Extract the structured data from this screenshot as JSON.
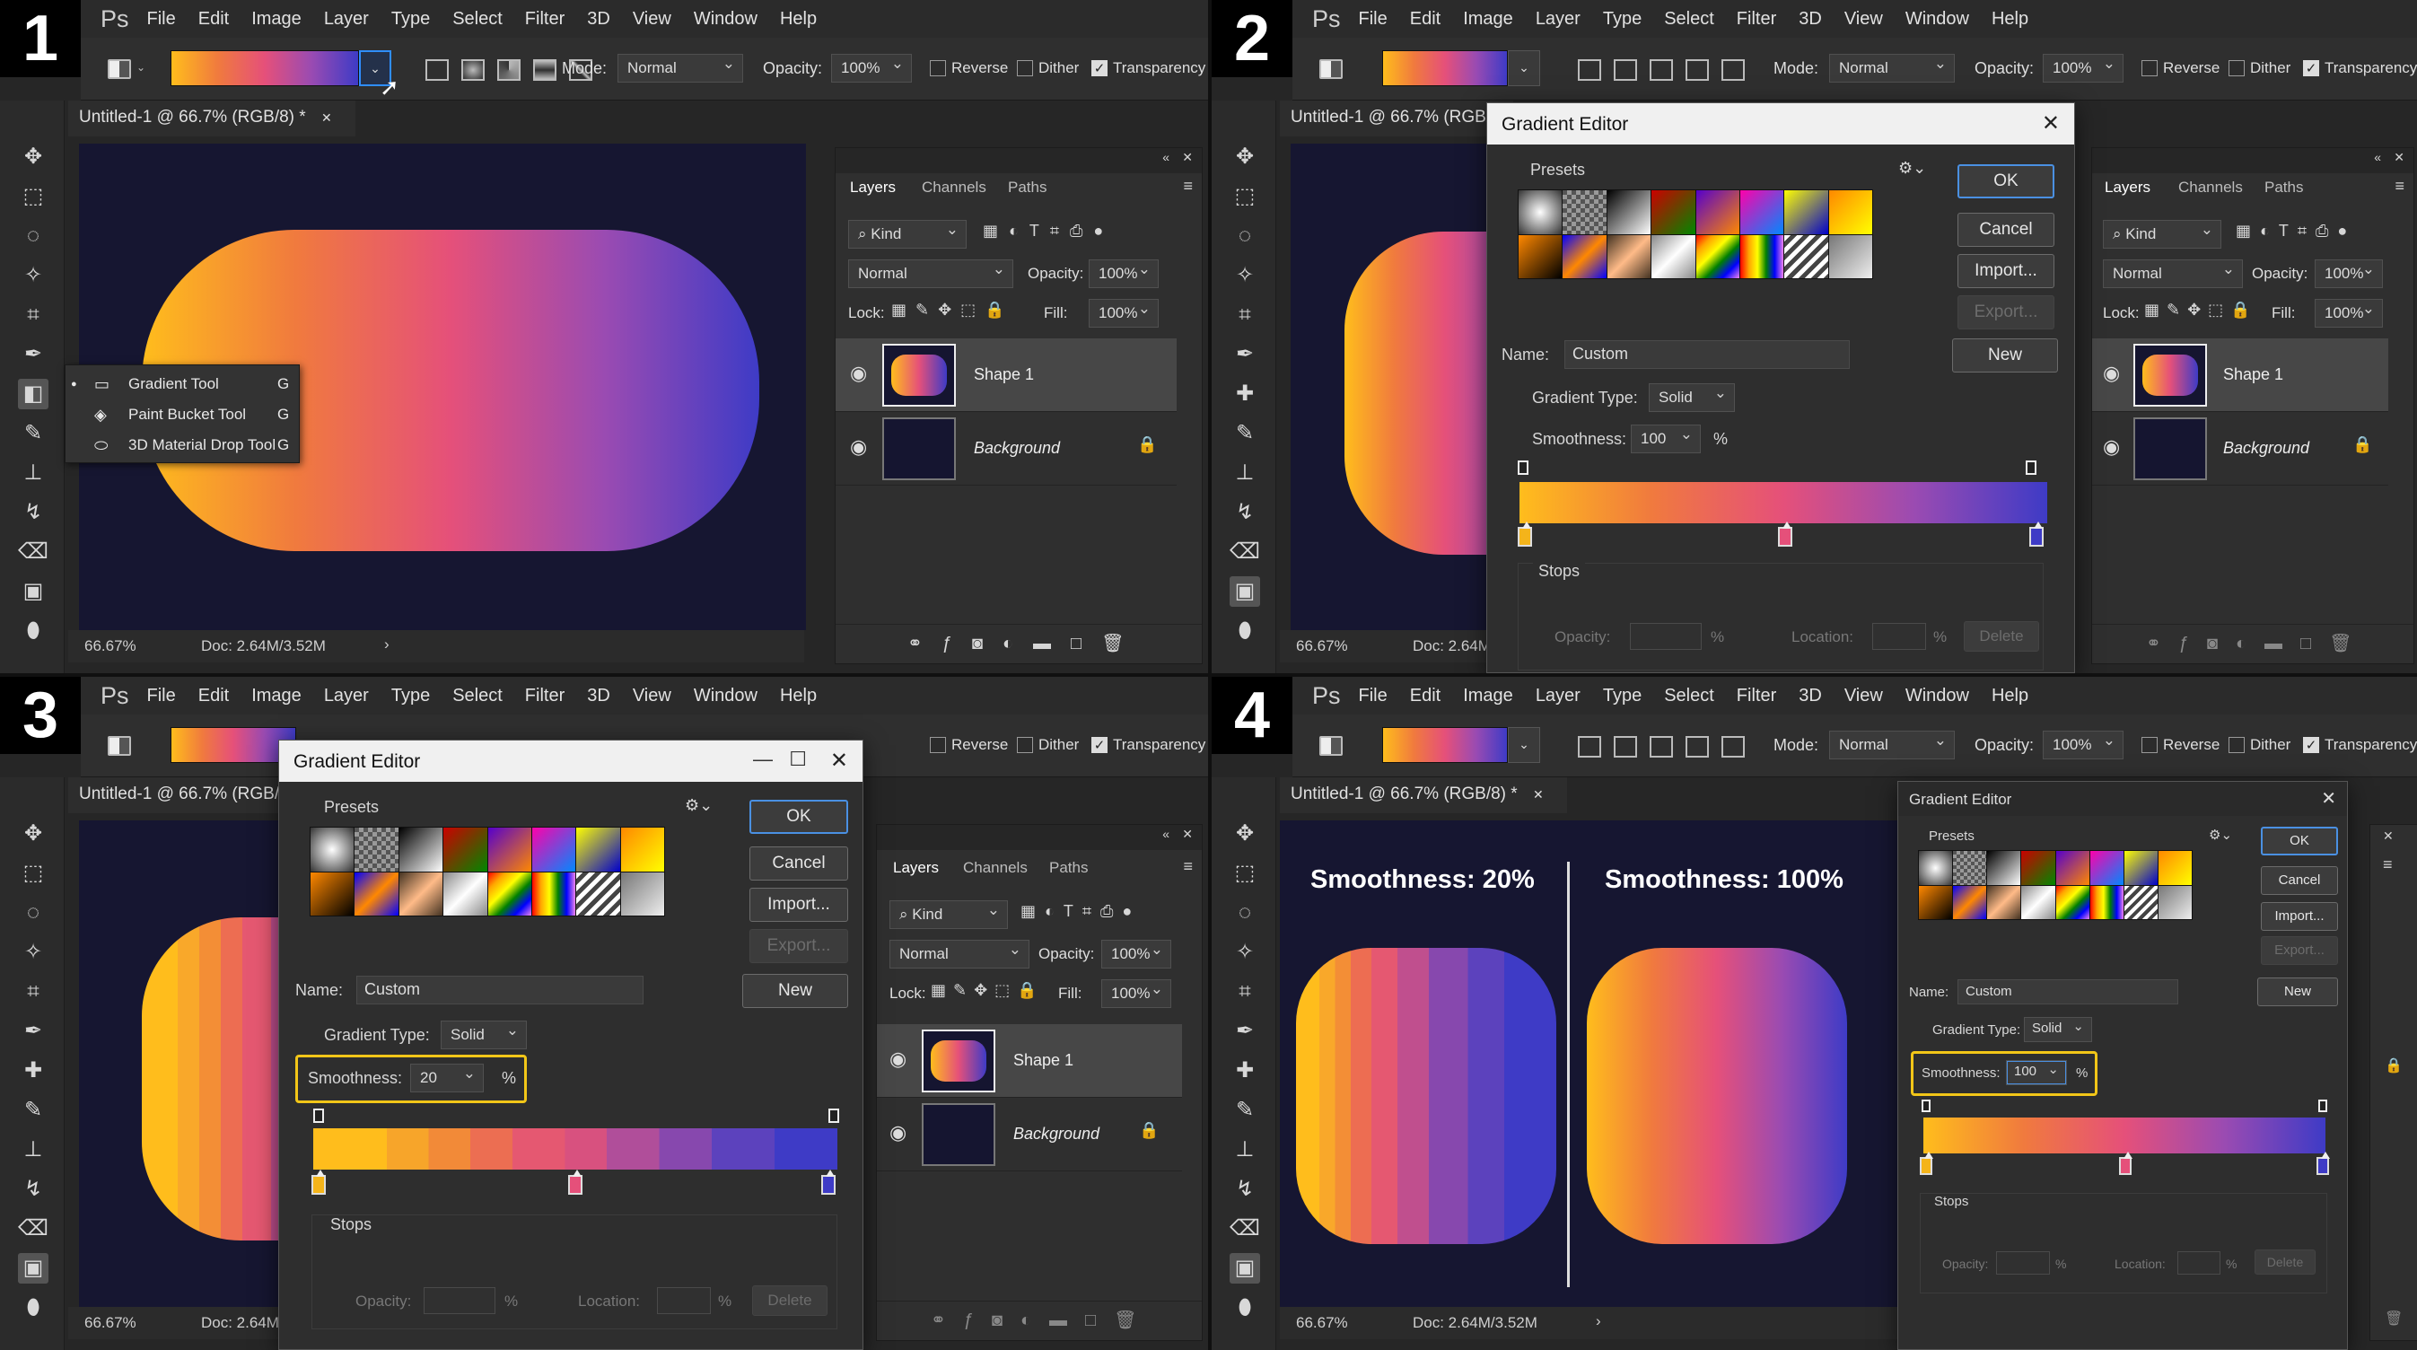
{
  "panels": [
    {
      "number": "1"
    },
    {
      "number": "2"
    },
    {
      "number": "3"
    },
    {
      "number": "4"
    }
  ],
  "app": {
    "logo": "Ps",
    "menu": [
      "File",
      "Edit",
      "Image",
      "Layer",
      "Type",
      "Select",
      "Filter",
      "3D",
      "View",
      "Window",
      "Help"
    ]
  },
  "options": {
    "mode_label": "Mode:",
    "mode_value": "Normal",
    "opacity_label": "Opacity:",
    "opacity_value": "100%",
    "reverse": "Reverse",
    "dither": "Dither",
    "transparency": "Transparency",
    "reverse_checked": false,
    "dither_checked": false,
    "transparency_checked": true
  },
  "document": {
    "tab_title": "Untitled-1 @ 66.7% (RGB/8) *",
    "tab_title_short": "Untitled-1 @ 66.7% (RGB/",
    "zoom": "66.67%",
    "doc_size": "Doc: 2.64M/3.52M"
  },
  "tool_menu": {
    "items": [
      {
        "label": "Gradient Tool",
        "key": "G",
        "icon": "gradient-icon"
      },
      {
        "label": "Paint Bucket Tool",
        "key": "G",
        "icon": "paint-bucket-icon"
      },
      {
        "label": "3D Material Drop Tool",
        "key": "G",
        "icon": "3d-material-drop-icon"
      }
    ]
  },
  "layers_panel": {
    "tabs": [
      "Layers",
      "Channels",
      "Paths"
    ],
    "filter_kind_q1": "Kind",
    "filter_kind": "Kind",
    "blend_mode": "Normal",
    "opacity_label": "Opacity:",
    "opacity_value": "100%",
    "lock_label": "Lock:",
    "fill_label": "Fill:",
    "fill_value": "100%",
    "layers": [
      {
        "name": "Shape 1",
        "selected": true,
        "locked": false
      },
      {
        "name": "Background",
        "selected": false,
        "locked": true
      }
    ]
  },
  "gradient_editor": {
    "title": "Gradient Editor",
    "presets_label": "Presets",
    "ok": "OK",
    "cancel": "Cancel",
    "import": "Import...",
    "export": "Export...",
    "new": "New",
    "name_label": "Name:",
    "name_value": "Custom",
    "gradient_type_label": "Gradient Type:",
    "gradient_type_value": "Solid",
    "smoothness_label": "Smoothness:",
    "smoothness_q2": "100",
    "smoothness_q3": "20",
    "smoothness_q4": "100",
    "percent": "%",
    "stops_label": "Stops",
    "stop_opacity_label": "Opacity:",
    "stop_location_label": "Location:",
    "delete": "Delete",
    "color_stops": [
      {
        "color": "#f4b41a",
        "location": 0
      },
      {
        "color": "#e5507a",
        "location": 50
      },
      {
        "color": "#3e3bc6",
        "location": 100
      }
    ],
    "gradient_colors": [
      "#ffbd1c",
      "#f07a3e",
      "#e5507a",
      "#9a4bb2",
      "#3e3bc6"
    ]
  },
  "comparison": {
    "left_title": "Smoothness: 20%",
    "right_title": "Smoothness: 100%"
  },
  "colors": {
    "canvas_bg": "#161631",
    "highlight": "#f2c618",
    "accent": "#2f8eff"
  }
}
